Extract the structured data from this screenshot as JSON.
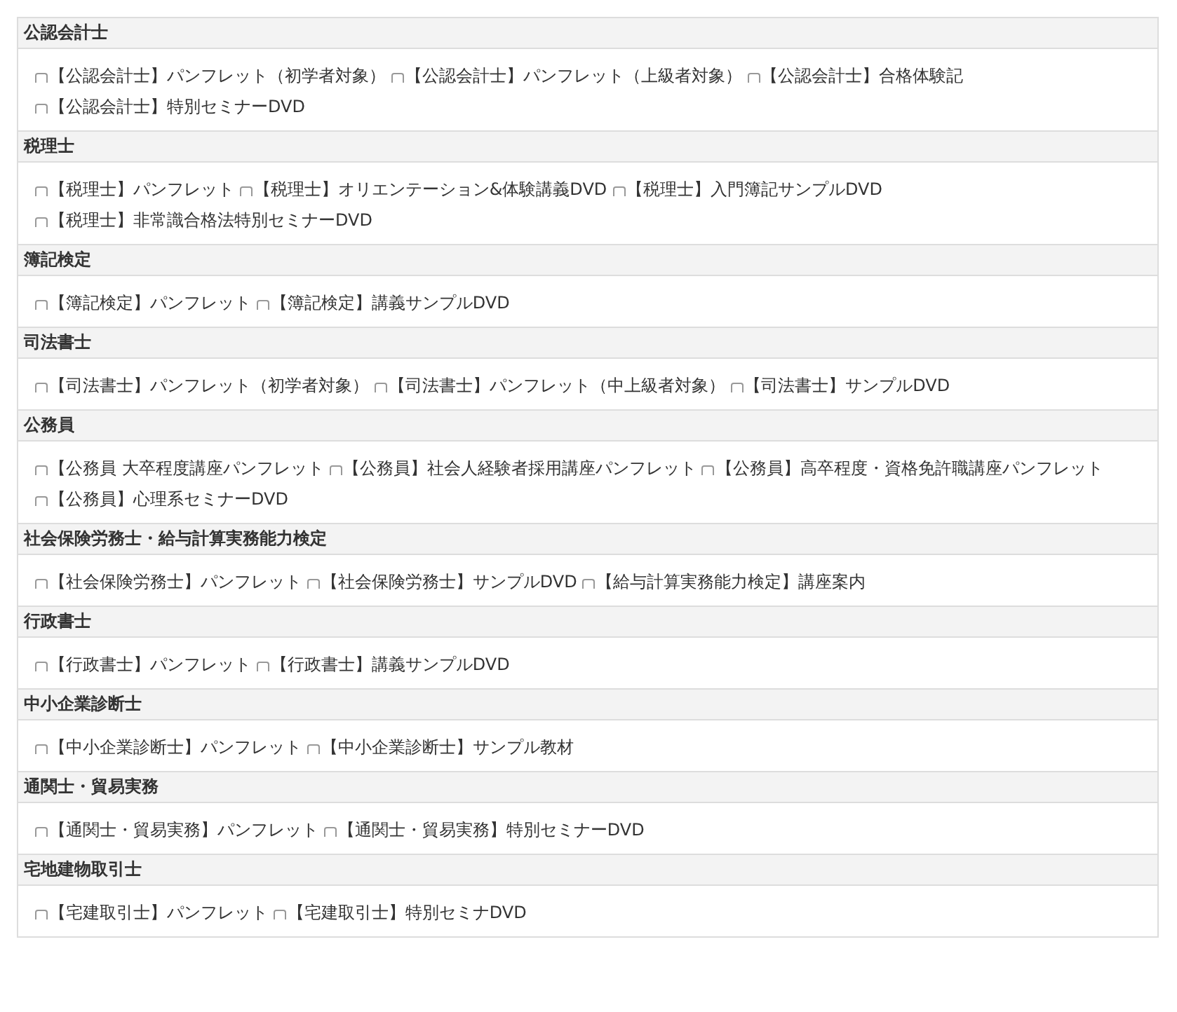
{
  "sections": [
    {
      "title": "公認会計士",
      "items": [
        {
          "label": "【公認会計士】パンフレット（初学者対象）",
          "checked": false
        },
        {
          "label": "【公認会計士】パンフレット（上級者対象）",
          "checked": false
        },
        {
          "label": "【公認会計士】合格体験記",
          "checked": false
        },
        {
          "label": "【公認会計士】特別セミナーDVD",
          "checked": false
        }
      ]
    },
    {
      "title": "税理士",
      "items": [
        {
          "label": "【税理士】パンフレット",
          "checked": false
        },
        {
          "label": "【税理士】オリエンテーション&体験講義DVD",
          "checked": false
        },
        {
          "label": "【税理士】入門簿記サンプルDVD",
          "checked": false
        },
        {
          "label": "【税理士】非常識合格法特別セミナーDVD",
          "checked": false
        }
      ]
    },
    {
      "title": "簿記検定",
      "items": [
        {
          "label": "【簿記検定】パンフレット",
          "checked": false
        },
        {
          "label": "【簿記検定】講義サンプルDVD",
          "checked": false
        }
      ]
    },
    {
      "title": "司法書士",
      "items": [
        {
          "label": "【司法書士】パンフレット（初学者対象）",
          "checked": false
        },
        {
          "label": "【司法書士】パンフレット（中上級者対象）",
          "checked": false
        },
        {
          "label": "【司法書士】サンプルDVD",
          "checked": false
        }
      ]
    },
    {
      "title": "公務員",
      "items": [
        {
          "label": "【公務員 大卒程度講座パンフレット",
          "checked": false
        },
        {
          "label": "【公務員】社会人経験者採用講座パンフレット",
          "checked": false
        },
        {
          "label": "【公務員】高卒程度・資格免許職講座パンフレット",
          "checked": false
        },
        {
          "label": "【公務員】心理系セミナーDVD",
          "checked": false
        }
      ]
    },
    {
      "title": "社会保険労務士・給与計算実務能力検定",
      "items": [
        {
          "label": "【社会保険労務士】パンフレット",
          "checked": false
        },
        {
          "label": "【社会保険労務士】サンプルDVD",
          "checked": false
        },
        {
          "label": "【給与計算実務能力検定】講座案内",
          "checked": false
        }
      ]
    },
    {
      "title": "行政書士",
      "items": [
        {
          "label": "【行政書士】パンフレット",
          "checked": false
        },
        {
          "label": "【行政書士】講義サンプルDVD",
          "checked": false
        }
      ]
    },
    {
      "title": "中小企業診断士",
      "items": [
        {
          "label": "【中小企業診断士】パンフレット",
          "checked": false
        },
        {
          "label": "【中小企業診断士】サンプル教材",
          "checked": false
        }
      ]
    },
    {
      "title": "通関士・貿易実務",
      "items": [
        {
          "label": "【通関士・貿易実務】パンフレット",
          "checked": false
        },
        {
          "label": "【通関士・貿易実務】特別セミナーDVD",
          "checked": false
        }
      ]
    },
    {
      "title": "宅地建物取引士",
      "items": [
        {
          "label": "【宅建取引士】パンフレット",
          "checked": false
        },
        {
          "label": "【宅建取引士】特別セミナDVD",
          "checked": false
        }
      ]
    }
  ]
}
